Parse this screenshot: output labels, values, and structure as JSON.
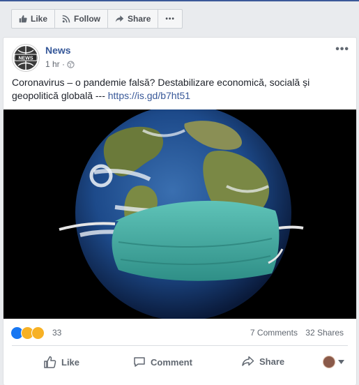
{
  "page_actions": {
    "like_label": "Like",
    "follow_label": "Follow",
    "share_label": "Share",
    "more_label": "•••"
  },
  "post": {
    "author": "News",
    "avatar_text": "NEWS",
    "time": "1 hr ·",
    "text": "Coronavirus – o pandemie falsă? Destabilizare economică, socială și geopolitică globală --- ",
    "link": "https://is.gd/b7ht51",
    "more": "•••"
  },
  "stats": {
    "reaction_count": "33",
    "comments": "7 Comments",
    "shares": "32 Shares",
    "reaction_colors": [
      "#1877f2",
      "#f7b125",
      "#f7b125"
    ]
  },
  "actions": {
    "like": "Like",
    "comment": "Comment",
    "share": "Share"
  }
}
